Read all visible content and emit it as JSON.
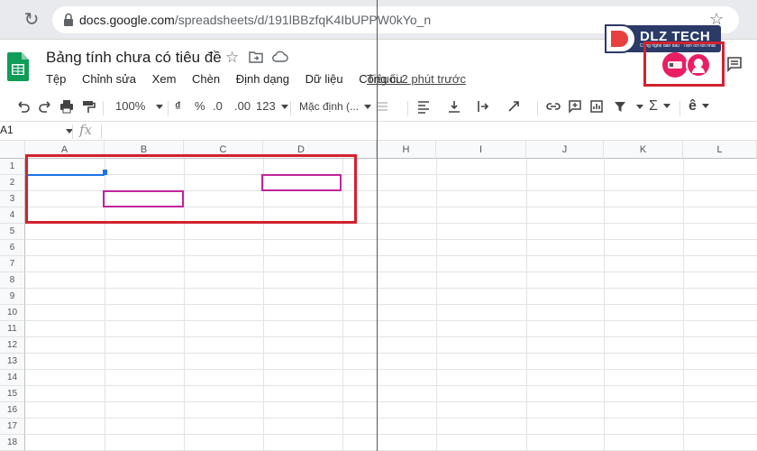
{
  "browser": {
    "url_main": "docs.google.com",
    "url_path": "/spreadsheets/d/191lBBzfqK4IbUPPW0kYo_n"
  },
  "doc": {
    "title": "Bảng tính chưa có tiêu đề",
    "menu": [
      "Tệp",
      "Chỉnh sửa",
      "Xem",
      "Chèn",
      "Định dạng",
      "Dữ liệu",
      "Công cụ"
    ],
    "last_edit": "Tiêuối 2 phút trước"
  },
  "brand": {
    "name": "DLZ TECH",
    "tagline": "Công nghệ dẫn đầu · Tiện ích tốt nhất"
  },
  "toolbar": {
    "zoom": "100%",
    "currency": "₫",
    "percent": "%",
    "dec_decrease": ".0",
    "dec_increase": ".00",
    "format_more": "123",
    "font": "Mặc định (...",
    "sigma": "Σ",
    "font_style": "ê"
  },
  "formula": {
    "cell_ref": "A1",
    "fx": "fx"
  },
  "grid": {
    "columns": [
      "A",
      "B",
      "C",
      "D",
      "H",
      "I",
      "J",
      "K",
      "L"
    ],
    "rows": [
      "1",
      "2",
      "3",
      "4",
      "5",
      "6",
      "7",
      "8",
      "9",
      "10",
      "11",
      "12",
      "13",
      "14",
      "15",
      "16",
      "17",
      "18"
    ]
  },
  "colors": {
    "accent": "#1a73e8",
    "annotation_red": "#d3212f",
    "annotation_pink": "#c0259d",
    "sheets_green": "#0f9d58"
  }
}
